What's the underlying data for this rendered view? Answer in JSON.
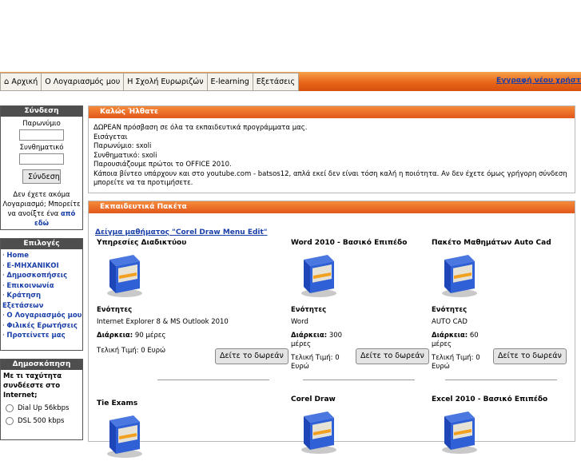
{
  "nav": {
    "items": [
      "Αρχική",
      "Ο Λογαριασμός μου",
      "Η Σχολή Ευρωριζών",
      "E-learning",
      "Εξετάσεις"
    ],
    "register_link": "Εγγραφή νέου χρήστη"
  },
  "login": {
    "title": "Σύνδεση",
    "username_label": "Παρωνύμιο",
    "password_label": "Συνθηματικό",
    "button": "Σύνδεση",
    "note": "Δεν έχετε ακόμα Λογαριασμό; Μπορείτε να ανοίξτε ένα",
    "note_link": "από εδώ"
  },
  "options": {
    "title": "Επιλογές",
    "items": [
      "Home",
      "E-ΜΗΧΑΝΙΚΟΙ",
      "Δημοσκοπήσεις",
      "Επικοινωνία",
      "Κράτηση Εξετάσεων",
      "Ο Λογαριασμός μου",
      "Φιλικές Ερωτήσεις",
      "Προτείνετε μας"
    ]
  },
  "poll": {
    "title": "Δημοσκόπηση",
    "question": "Με τι ταχύτητα συνδέεστε στο Internet;",
    "options": [
      "Dial Up 56kbps",
      "DSL 500 kbps"
    ]
  },
  "welcome": {
    "title": "Καλώς Ήλθατε",
    "lines": [
      "ΔΩΡΕΑΝ πρόσβαση σε όλα τα εκπαιδευτικά προγράμματα μας.",
      "Εισάγεται",
      "Παρωνύμιο: sxoli",
      "Συνθηματικό: sxoli",
      "Παρουσιάζουμε πρώτοι το OFFICE 2010.",
      "Κάποια βίντεο υπάρχουν και στο youtube.com - batsos12, απλά εκεί δεν είναι τόση καλή η ποιότητα. Αν δεν έχετε όμως γρήγορη σύνδεση μπορείτε να τα προτιμήσετε."
    ]
  },
  "packages": {
    "title": "Εκπαιδευτικά Πακέτα",
    "sample_link": "Δείγμα μαθήματος \"Corel Draw Menu Edit\"",
    "sections_label": "Ενότητες",
    "duration_label": "Διάρκεια:",
    "button_label": "Δείτε το δωρεάν",
    "items": [
      {
        "title": "Υπηρεσίες Διαδικτύου",
        "sections": "Internet Explorer 8 & MS Outlook 2010",
        "duration": "90 μέρες",
        "price": "Τελική Τιμή: 0 Ευρώ"
      },
      {
        "title": "Word 2010 - Βασικό Επιπέδο",
        "sections": "Word",
        "duration": "300 μέρες",
        "price": "Τελική Τιμή: 0 Ευρώ"
      },
      {
        "title": "Πακέτο Μαθημάτων Auto Cad",
        "sections": "AUTO CAD",
        "duration": "60 μέρες",
        "price": "Τελική Τιμή: 0 Ευρώ"
      },
      {
        "title": "Tie Exams"
      },
      {
        "title": "Corel Draw"
      },
      {
        "title": "Excel 2010 - Βασικό Επιπέδο"
      }
    ]
  }
}
